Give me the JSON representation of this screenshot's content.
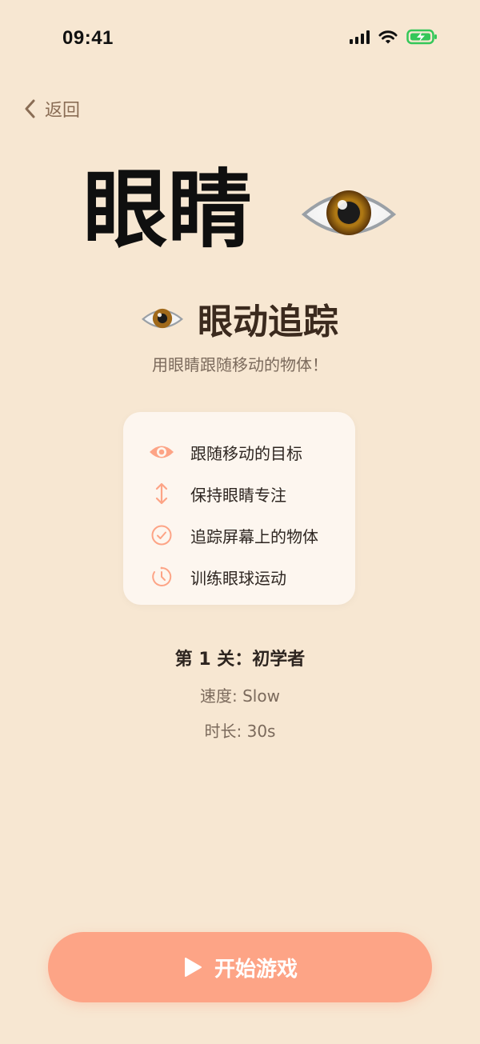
{
  "status_bar": {
    "time": "09:41",
    "icons": [
      "cellular-signal-icon",
      "wifi-icon",
      "battery-charging-icon"
    ],
    "battery_color": "#34c759"
  },
  "nav": {
    "back_label": "返回",
    "back_icon": "chevron-left-icon"
  },
  "hero": {
    "title": "眼睛",
    "emoji_name": "eye-icon"
  },
  "activity": {
    "title": "眼动追踪",
    "description": "用眼睛跟随移动的物体！"
  },
  "features": [
    {
      "label": "跟随移动的目标",
      "icon": "eye-icon"
    },
    {
      "label": "保持眼睛专注",
      "icon": "vertical-arrows-icon"
    },
    {
      "label": "追踪屏幕上的物体",
      "icon": "check-circle-icon"
    },
    {
      "label": "训练眼球运动",
      "icon": "timer-icon"
    }
  ],
  "level": {
    "title": "第 1 关：初学者",
    "speed": "速度: Slow",
    "duration": "时长: 30s"
  },
  "start_button": {
    "label": "开始游戏",
    "icon": "play-icon"
  },
  "colors": {
    "background": "#f7e7d2",
    "accent": "#fda486",
    "card": "#fdf6ef"
  }
}
